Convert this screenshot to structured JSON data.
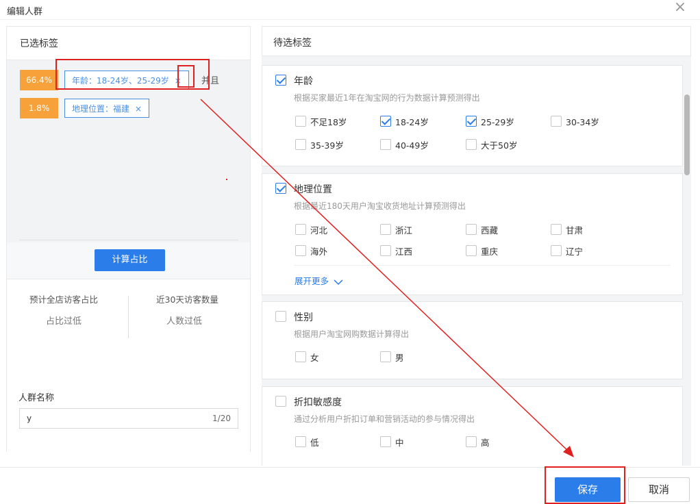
{
  "dialog": {
    "title": "编辑人群",
    "close_icon": "×"
  },
  "left": {
    "title": "已选标签",
    "tags": [
      {
        "pct": "66.4%",
        "label": "年龄：18-24岁、25-29岁",
        "remove": "×"
      },
      {
        "pct": "1.8%",
        "label": "地理位置：福建",
        "remove": "×"
      }
    ],
    "and_label": "并且",
    "calc_button": "计算占比",
    "stats": {
      "ratio_label": "预计全店访客占比",
      "ratio_value": "占比过低",
      "count_label": "近30天访客数量",
      "count_value": "人数过低"
    },
    "name_label": "人群名称",
    "name_value": "y",
    "name_count": "1/20"
  },
  "right": {
    "title": "待选标签",
    "sections": [
      {
        "title": "年龄",
        "checked": true,
        "desc": "根据买家最近1年在淘宝网的行为数据计算预测得出",
        "options": [
          {
            "label": "不足18岁",
            "checked": false
          },
          {
            "label": "18-24岁",
            "checked": true
          },
          {
            "label": "25-29岁",
            "checked": true
          },
          {
            "label": "30-34岁",
            "checked": false
          },
          {
            "label": "35-39岁",
            "checked": false
          },
          {
            "label": "40-49岁",
            "checked": false
          },
          {
            "label": "大于50岁",
            "checked": false
          }
        ]
      },
      {
        "title": "地理位置",
        "checked": true,
        "desc": "根据最近180天用户淘宝收货地址计算预测得出",
        "options": [
          {
            "label": "河北",
            "checked": false
          },
          {
            "label": "浙江",
            "checked": false
          },
          {
            "label": "西藏",
            "checked": false
          },
          {
            "label": "甘肃",
            "checked": false
          },
          {
            "label": "海外",
            "checked": false
          },
          {
            "label": "江西",
            "checked": false
          },
          {
            "label": "重庆",
            "checked": false
          },
          {
            "label": "辽宁",
            "checked": false
          }
        ],
        "more": "展开更多"
      },
      {
        "title": "性别",
        "checked": false,
        "desc": "根据用户淘宝网购数据计算得出",
        "options": [
          {
            "label": "女",
            "checked": false
          },
          {
            "label": "男",
            "checked": false
          }
        ]
      },
      {
        "title": "折扣敏感度",
        "checked": false,
        "desc": "通过分析用户折扣订单和营销活动的参与情况得出",
        "options": [
          {
            "label": "低",
            "checked": false
          },
          {
            "label": "中",
            "checked": false
          },
          {
            "label": "高",
            "checked": false
          }
        ]
      }
    ]
  },
  "footer": {
    "save": "保存",
    "cancel": "取消"
  },
  "colors": {
    "primary": "#2b7de9",
    "pct_badge": "#f7a13a",
    "highlight": "#e02020"
  }
}
